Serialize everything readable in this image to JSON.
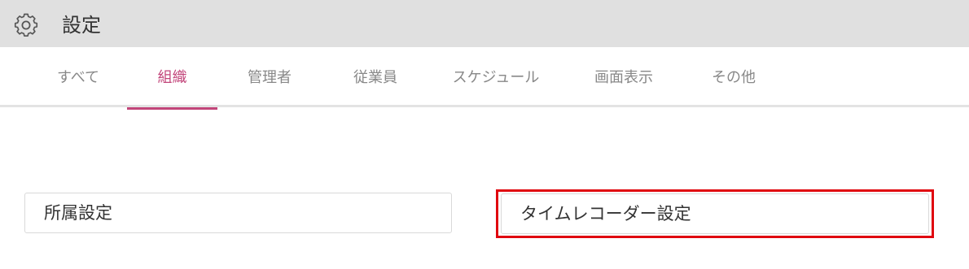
{
  "header": {
    "icon": "gear-icon",
    "title": "設定"
  },
  "tabs": [
    {
      "label": "すべて",
      "active": false
    },
    {
      "label": "組織",
      "active": true
    },
    {
      "label": "管理者",
      "active": false
    },
    {
      "label": "従業員",
      "active": false
    },
    {
      "label": "スケジュール",
      "active": false
    },
    {
      "label": "画面表示",
      "active": false
    },
    {
      "label": "その他",
      "active": false
    }
  ],
  "cards": [
    {
      "label": "所属設定"
    },
    {
      "label": "タイムレコーダー設定",
      "highlighted": true
    }
  ],
  "colors": {
    "accent": "#c2457a",
    "highlight": "#e0060f",
    "header_bg": "#e0e0e0"
  }
}
